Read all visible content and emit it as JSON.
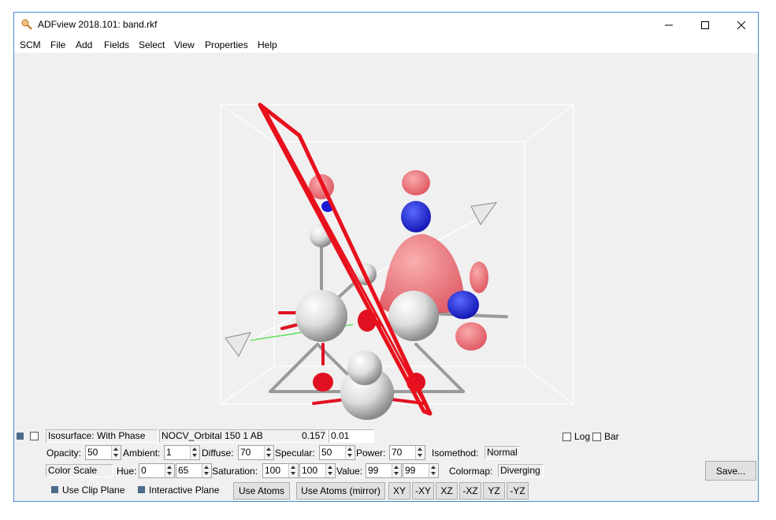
{
  "window": {
    "title": "ADFview 2018.101: band.rkf"
  },
  "menu": [
    "SCM",
    "File",
    "Add",
    "Fields",
    "Select",
    "View",
    "Properties",
    "Help"
  ],
  "row1": {
    "isosurface": "Isosurface: With Phase",
    "orbital": "NOCV_Orbital 150 1 AB",
    "iso_value": "0.157",
    "iso_value2": "0.01",
    "log_label": "Log",
    "bar_label": "Bar"
  },
  "row2": {
    "opacity_label": "Opacity:",
    "opacity": "50",
    "ambient_label": "Ambient:",
    "ambient": "1",
    "diffuse_label": "Diffuse:",
    "diffuse": "70",
    "specular_label": "Specular:",
    "specular": "50",
    "power_label": "Power:",
    "power": "70",
    "isomethod_label": "Isomethod:",
    "isomethod": "Normal"
  },
  "row3": {
    "colorscale": "Color Scale",
    "hue_label": "Hue:",
    "hue1": "0",
    "hue2": "65",
    "saturation_label": "Saturation:",
    "sat1": "100",
    "sat2": "100",
    "value_label": "Value:",
    "val1": "99",
    "val2": "99",
    "colormap_label": "Colormap:",
    "colormap": "Diverging",
    "save_label": "Save..."
  },
  "row4": {
    "clip_plane": "Use Clip Plane",
    "interactive_plane": "Interactive Plane",
    "use_atoms": "Use Atoms",
    "use_atoms_mirror": "Use Atoms (mirror)",
    "planes": [
      "XY",
      "-XY",
      "XZ",
      "-XZ",
      "YZ",
      "-YZ"
    ]
  },
  "colors": {
    "accent": "#4a8bd6",
    "isosurface_positive": "#e8141e",
    "isosurface_negative": "#1a1ad6",
    "atom": "#e6e6e6"
  }
}
